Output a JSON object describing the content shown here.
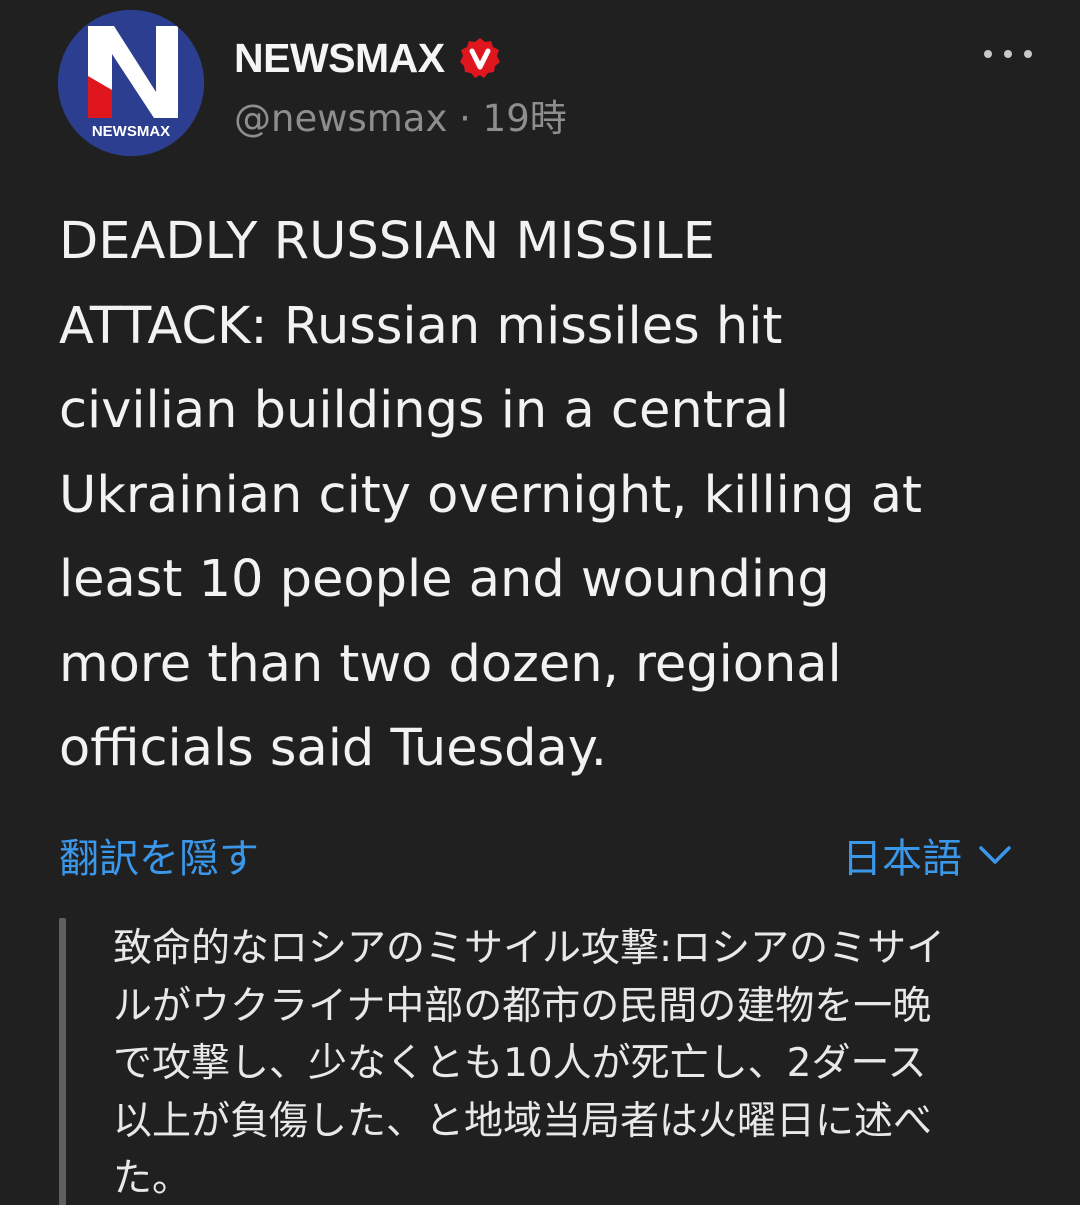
{
  "author": {
    "display_name": "NEWSMAX",
    "handle": "@newsmax",
    "separator": "·",
    "time": "19時",
    "avatar_text": "NEWSMAX",
    "avatar_letter": "N",
    "verified_badge_letter": "v"
  },
  "tweet": {
    "lines": [
      "DEADLY RUSSIAN MISSILE",
      "ATTACK: Russian missiles hit",
      "civilian buildings in a central",
      "Ukrainian city overnight, killing at",
      "least 10 people and wounding",
      "more than two dozen, regional",
      "officials said Tuesday."
    ]
  },
  "translation": {
    "hide_label": "翻訳を隠す",
    "language": "日本語",
    "lines": [
      "致命的なロシアのミサイル攻撃:ロシアのミサイ",
      "ルがウクライナ中部の都市の民間の建物を一晩",
      "で攻撃し、少なくとも10人が死亡し、2ダース",
      "以上が負傷した、と地域当局者は火曜日に述べ",
      "た。"
    ]
  },
  "icons": {
    "more": "more-horizontal-icon",
    "verified": "verified-badge-icon",
    "chevron": "chevron-down-icon"
  },
  "colors": {
    "background": "#202020",
    "link": "#3a97ea",
    "badge": "#e0161f",
    "avatar_blue": "#2c3e8f",
    "muted": "#8e8e8e"
  }
}
